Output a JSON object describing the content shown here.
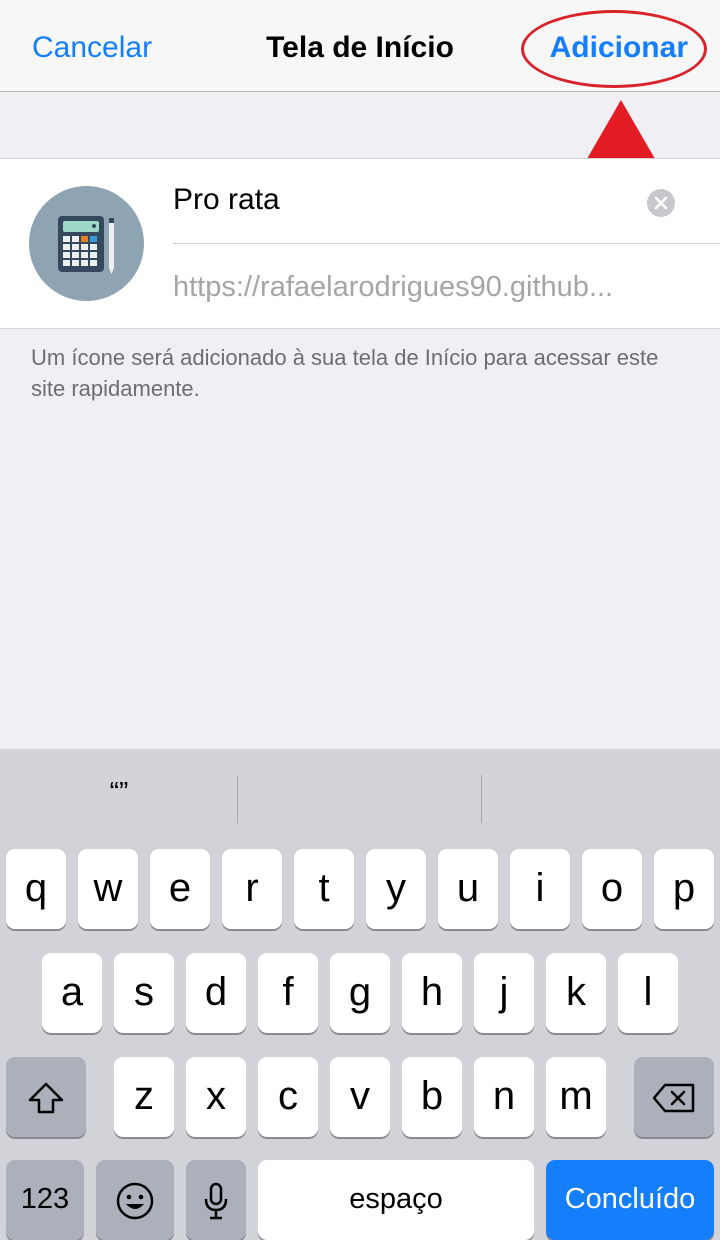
{
  "navbar": {
    "cancel_label": "Cancelar",
    "title": "Tela de Início",
    "add_label": "Adicionar"
  },
  "card": {
    "icon": "calculator-icon",
    "name_value": "Pro rata",
    "url_text": "https://rafaelarodrigues90.github..."
  },
  "helper_text": "Um ícone será adicionado à sua tela de Início para acessar este site rapidamente.",
  "keyboard": {
    "suggestions": [
      "“”",
      "",
      ""
    ],
    "row1": [
      "q",
      "w",
      "e",
      "r",
      "t",
      "y",
      "u",
      "i",
      "o",
      "p"
    ],
    "row2": [
      "a",
      "s",
      "d",
      "f",
      "g",
      "h",
      "j",
      "k",
      "l"
    ],
    "row3": [
      "z",
      "x",
      "c",
      "v",
      "b",
      "n",
      "m"
    ],
    "numbers_label": "123",
    "space_label": "espaço",
    "done_label": "Concluído",
    "shift_icon": "shift-icon",
    "backspace_icon": "backspace-icon",
    "emoji_icon": "emoji-icon",
    "mic_icon": "microphone-icon"
  },
  "colors": {
    "accent": "#157efb",
    "annotation": "#e31b23"
  }
}
